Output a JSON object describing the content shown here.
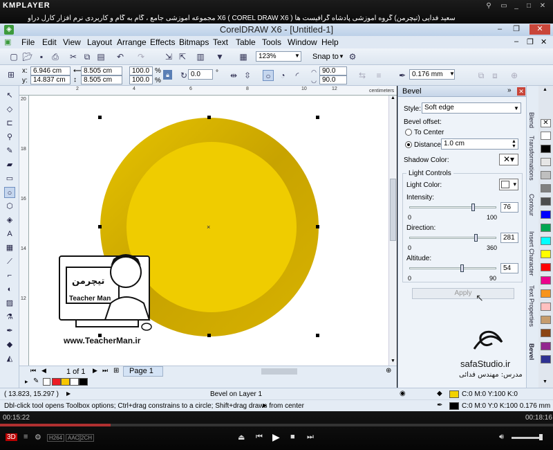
{
  "kmplayer": {
    "logo": "KMPLAYER",
    "title": "مجموعه آموزشی جامع ، گام به گام و کاربردی نرم افزار کارل دراو X6 ( COREL DRAW X6 )   مدرس : سعید فدایی (تیچرمن) گروه آموزشی پادشاه گرافیست ها",
    "elapsed": "00:15:22",
    "total": "00:18:16",
    "progress": 0.2,
    "badges": [
      "3D",
      "H264",
      "AAC",
      "2CH"
    ]
  },
  "window": {
    "title": "CorelDRAW X6 - [Untitled-1]",
    "min": "–",
    "restore": "❐",
    "close": "✕"
  },
  "menu": [
    "File",
    "Edit",
    "View",
    "Layout",
    "Arrange",
    "Effects",
    "Bitmaps",
    "Text",
    "Table",
    "Tools",
    "Window",
    "Help"
  ],
  "toolbar": {
    "zoom": "123%",
    "snap_to": "Snap to"
  },
  "propbar": {
    "x_label": "x:",
    "y_label": "y:",
    "x": "6.946 cm",
    "y": "14.837 cm",
    "w": "8.505 cm",
    "h": "8.505 cm",
    "scale_w": "100.0",
    "scale_h": "100.0",
    "pct": "%",
    "angle": "0.0",
    "deg": "°",
    "start_angle": "90.0",
    "end_angle": "90.0",
    "outline": "0.176 mm"
  },
  "ruler": {
    "h_ticks": [
      "2",
      "4",
      "6",
      "8",
      "10",
      "12"
    ],
    "v_ticks": [
      "20",
      "18",
      "16",
      "14",
      "12"
    ],
    "units": "centimeters"
  },
  "pagebar": {
    "page_count": "1 of 1",
    "page_tab": "Page 1"
  },
  "watermark": {
    "teacher_title": "Teacher Man",
    "url": "www.TeacherMan.ir",
    "studio": "safaStudio.ir",
    "instructor": "مدرس: مهندس فدائی"
  },
  "docker": {
    "title": "Bevel",
    "style_label": "Style:",
    "style_value": "Soft edge",
    "offset_label": "Bevel offset:",
    "to_center": "To Center",
    "distance": "Distance:",
    "distance_value": "1.0 cm",
    "shadow_color": "Shadow Color:",
    "light_controls": "Light Controls",
    "light_color": "Light Color:",
    "intensity_label": "Intensity:",
    "intensity_value": "76",
    "intensity_min": "0",
    "intensity_max": "100",
    "direction_label": "Direction:",
    "direction_value": "281",
    "direction_min": "0",
    "direction_max": "360",
    "altitude_label": "Altitude:",
    "altitude_value": "54",
    "altitude_min": "0",
    "altitude_max": "90",
    "apply": "Apply"
  },
  "docker_tabs": [
    "Bevel",
    "Text Properties",
    "Insert Character",
    "Contour",
    "Transformations",
    "Blend"
  ],
  "palette": [
    "#ffffff",
    "#000000",
    "#e6e6e6",
    "#bfbfbf",
    "#808080",
    "#4d4d4d",
    "#0000ff",
    "#00a651",
    "#00ffff",
    "#ffff00",
    "#ff0000",
    "#ec008c",
    "#f7941d",
    "#ffc0c0",
    "#c69c6d",
    "#8b4513",
    "#92278f",
    "#2e3192"
  ],
  "doc_palette": [
    "#ec1c24",
    "#f7c600",
    "#ffffff",
    "#000000"
  ],
  "status": {
    "coords": "( 13.823, 15.297 )",
    "object_info": "Bevel on Layer 1",
    "hint": "Dbl-click tool opens Toolbox options; Ctrl+drag constrains to a circle; Shift+drag draws from center",
    "fill_info": "C:0 M:0 Y:100 K:0",
    "outline_info": "C:0 M:0 Y:0 K:100  0.176 mm",
    "fill_color": "#f2d200",
    "outline_color": "#000000"
  }
}
